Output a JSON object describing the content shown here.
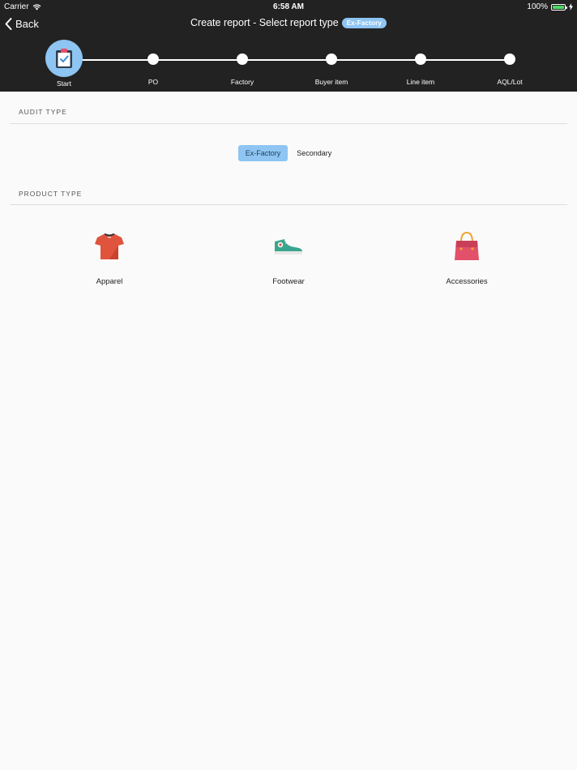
{
  "status_bar": {
    "carrier": "Carrier",
    "time": "6:58 AM",
    "battery": "100%"
  },
  "nav": {
    "back_label": "Back",
    "title": "Create report - Select report type",
    "badge": "Ex-Factory"
  },
  "stepper": {
    "steps": [
      {
        "label": "Start",
        "active": true
      },
      {
        "label": "PO",
        "active": false
      },
      {
        "label": "Factory",
        "active": false
      },
      {
        "label": "Buyer item",
        "active": false
      },
      {
        "label": "Line item",
        "active": false
      },
      {
        "label": "AQL/Lot",
        "active": false
      }
    ]
  },
  "audit_type": {
    "title": "AUDIT TYPE",
    "options": [
      {
        "label": "Ex-Factory",
        "selected": true
      },
      {
        "label": "Secondary",
        "selected": false
      }
    ]
  },
  "product_type": {
    "title": "PRODUCT TYPE",
    "items": [
      {
        "label": "Apparel",
        "icon": "tshirt-icon"
      },
      {
        "label": "Footwear",
        "icon": "sneaker-icon"
      },
      {
        "label": "Accessories",
        "icon": "handbag-icon"
      }
    ]
  },
  "colors": {
    "header_bg": "#222222",
    "accent": "#8ec5f2",
    "apparel": "#e0533c",
    "footwear": "#3aa58f",
    "accessories": "#e2506a"
  }
}
